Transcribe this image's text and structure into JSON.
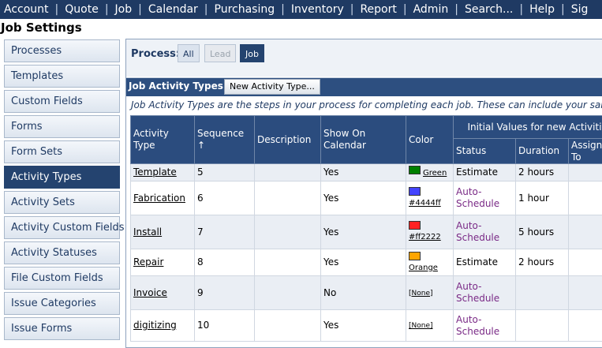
{
  "nav": {
    "items": [
      "Account",
      "Quote",
      "Job",
      "Calendar",
      "Purchasing",
      "Inventory",
      "Report",
      "Admin",
      "Search...",
      "Help",
      "Sig"
    ]
  },
  "page_title": "Job Settings",
  "sidebar": {
    "items": [
      {
        "label": "Processes"
      },
      {
        "label": "Templates"
      },
      {
        "label": "Custom Fields"
      },
      {
        "label": "Forms"
      },
      {
        "label": "Form Sets"
      },
      {
        "label": "Activity Types"
      },
      {
        "label": "Activity Sets"
      },
      {
        "label": "Activity Custom Fields"
      },
      {
        "label": "Activity Statuses"
      },
      {
        "label": "File Custom Fields"
      },
      {
        "label": "Issue Categories"
      },
      {
        "label": "Issue Forms"
      }
    ],
    "active": "Activity Types"
  },
  "process": {
    "label": "Process:",
    "buttons": [
      "All",
      "Lead",
      "Job"
    ],
    "selected": "Job"
  },
  "activity_types": {
    "title": "Job Activity Types:",
    "new_button": "New Activity Type...",
    "intro": "Job Activity Types are the steps in your process for completing each job. These can include your sales,",
    "headers": {
      "activity_type": "Activity Type",
      "sequence": "Sequence ↑",
      "description": "Description",
      "show_on_calendar": "Show On Calendar",
      "color": "Color",
      "initial_values": "Initial Values for new Activiti",
      "status": "Status",
      "duration": "Duration",
      "assign_to": "Assign To"
    },
    "rows": [
      {
        "name": "Template",
        "sequence": "5",
        "description": "",
        "show": "Yes",
        "swatch": "#008000",
        "color_label": "Green",
        "status": "Estimate",
        "status_auto": false,
        "duration": "2 hours",
        "assign": ""
      },
      {
        "name": "Fabrication",
        "sequence": "6",
        "description": "",
        "show": "Yes",
        "swatch": "#4444ff",
        "color_label": "#4444ff",
        "status": "Auto-Schedule",
        "status_auto": true,
        "duration": "1 hour",
        "assign": ""
      },
      {
        "name": "Install",
        "sequence": "7",
        "description": "",
        "show": "Yes",
        "swatch": "#ff2222",
        "color_label": "#ff2222",
        "status": "Auto-Schedule",
        "status_auto": true,
        "duration": "5 hours",
        "assign": ""
      },
      {
        "name": "Repair",
        "sequence": "8",
        "description": "",
        "show": "Yes",
        "swatch": "#ffa500",
        "color_label": "Orange",
        "status": "Estimate",
        "status_auto": false,
        "duration": "2 hours",
        "assign": ""
      },
      {
        "name": "Invoice",
        "sequence": "9",
        "description": "",
        "show": "No",
        "swatch": "",
        "color_label": "[None]",
        "status": "Auto-Schedule",
        "status_auto": true,
        "duration": "",
        "assign": ""
      },
      {
        "name": "digitizing",
        "sequence": "10",
        "description": "",
        "show": "Yes",
        "swatch": "",
        "color_label": "[None]",
        "status": "Auto-Schedule",
        "status_auto": true,
        "duration": "",
        "assign": ""
      }
    ]
  }
}
